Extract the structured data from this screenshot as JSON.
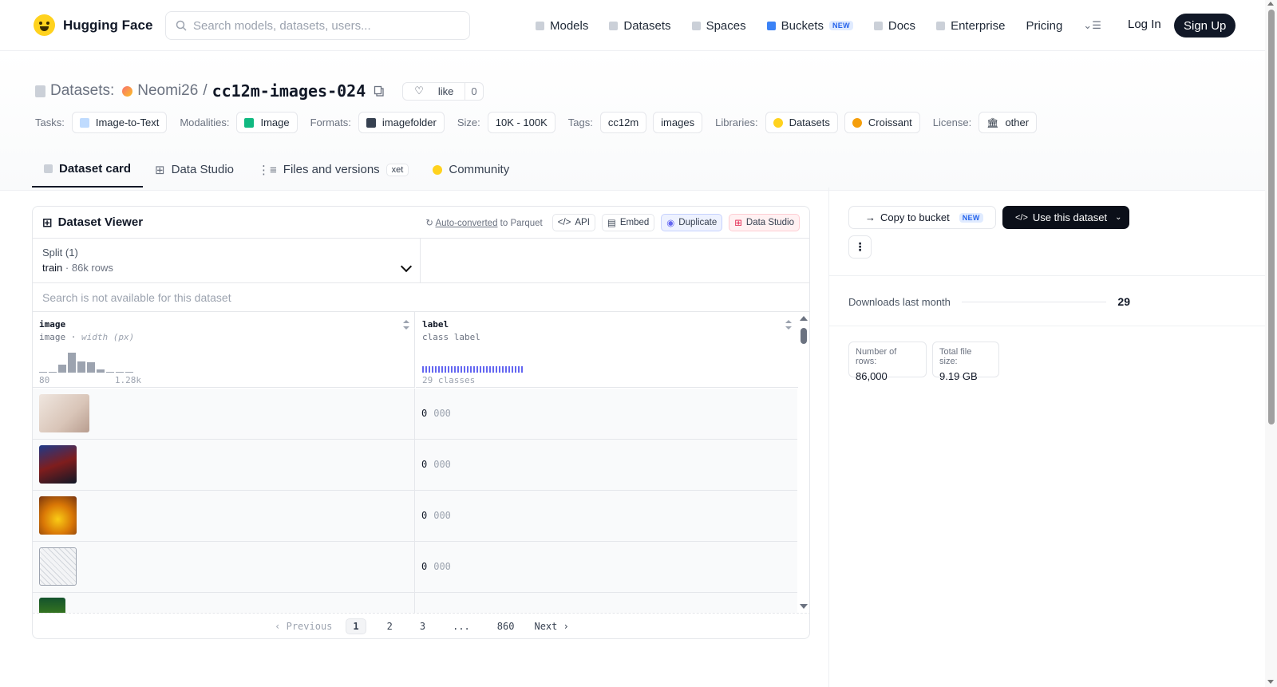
{
  "nav": {
    "brand": "Hugging Face",
    "search_placeholder": "Search models, datasets, users...",
    "links": [
      "Models",
      "Datasets",
      "Spaces",
      "Buckets",
      "Docs",
      "Enterprise",
      "Pricing"
    ],
    "new_badge": "NEW",
    "login": "Log In",
    "signup": "Sign Up"
  },
  "header": {
    "section": "Datasets:",
    "owner": "Neomi26",
    "separator": "/",
    "repo": "cc12m-images-024",
    "like_label": "like",
    "like_count": "0"
  },
  "tags": {
    "tasks_label": "Tasks:",
    "task": "Image-to-Text",
    "modalities_label": "Modalities:",
    "modality": "Image",
    "formats_label": "Formats:",
    "format": "imagefolder",
    "size_label": "Size:",
    "size": "10K - 100K",
    "tags_label": "Tags:",
    "tag1": "cc12m",
    "tag2": "images",
    "libraries_label": "Libraries:",
    "lib1": "Datasets",
    "lib2": "Croissant",
    "license_label": "License:",
    "license": "other"
  },
  "tabs": {
    "card": "Dataset card",
    "studio": "Data Studio",
    "files": "Files and versions",
    "xet": "xet",
    "community": "Community"
  },
  "viewer": {
    "title": "Dataset Viewer",
    "auto_converted": "Auto-converted",
    "to_parquet": " to Parquet",
    "api": "API",
    "embed": "Embed",
    "duplicate": "Duplicate",
    "data_studio": "Data Studio",
    "split_label": "Split (1)",
    "split_value": "train",
    "split_rows": "86k rows",
    "search_unavailable": "Search is not available for this dataset",
    "col1": {
      "name": "image",
      "type": "image",
      "stat": "width (px)",
      "min": "80",
      "max": "1.28k",
      "hist": [
        0.05,
        0.05,
        0.35,
        0.9,
        0.5,
        0.45,
        0.15,
        0.05,
        0.05,
        0.05
      ]
    },
    "col2": {
      "name": "label",
      "type": "class label",
      "classes": "29 classes"
    },
    "rows": [
      {
        "label": "0",
        "label_name": "000"
      },
      {
        "label": "0",
        "label_name": "000"
      },
      {
        "label": "0",
        "label_name": "000"
      },
      {
        "label": "0",
        "label_name": "000"
      }
    ],
    "pager": {
      "prev": "Previous",
      "p1": "1",
      "p2": "2",
      "p3": "3",
      "ellipsis": "...",
      "last": "860",
      "next": "Next"
    }
  },
  "sidebar": {
    "copy_bucket": "Copy to bucket",
    "use_dataset": "Use this dataset",
    "downloads_label": "Downloads last month",
    "downloads": "29",
    "rows_label": "Number of rows:",
    "rows_value": "86,000",
    "size_label": "Total file size:",
    "size_value": "9.19 GB"
  }
}
